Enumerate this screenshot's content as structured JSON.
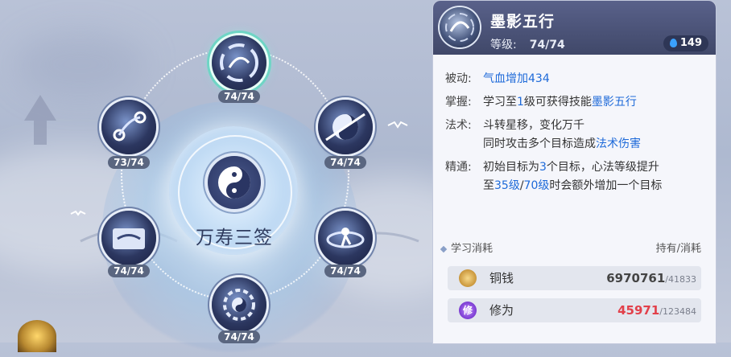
{
  "skill_tree": {
    "center_title": "万寿三签",
    "nodes": [
      {
        "id": "top",
        "label": "74/74",
        "active": true
      },
      {
        "id": "upper-left",
        "label": "73/74",
        "active": false
      },
      {
        "id": "upper-right",
        "label": "74/74",
        "active": false
      },
      {
        "id": "lower-left",
        "label": "74/74",
        "active": false
      },
      {
        "id": "lower-right",
        "label": "74/74",
        "active": false
      },
      {
        "id": "bottom",
        "label": "74/74",
        "active": false
      }
    ]
  },
  "detail": {
    "title": "墨影五行",
    "level_label": "等级:",
    "level_value": "74/74",
    "currency_badge": "149",
    "rows": [
      {
        "key": "被动:",
        "text_prefix": "",
        "highlight": "气血增加434",
        "text_suffix": ""
      },
      {
        "key": "掌握:",
        "text_prefix": "学习至",
        "highlight": "1",
        "text_suffix": "级可获得技能",
        "highlight2": "墨影五行"
      },
      {
        "key": "法术:",
        "line1": "斗转星移，变化万千",
        "line2_prefix": "同时攻击多个目标造成",
        "line2_highlight": "法术伤害"
      },
      {
        "key": "精通:",
        "line1_prefix": "初始目标为",
        "line1_highlight": "3",
        "line1_suffix": "个目标，心法等级提升",
        "line2_prefix": "至",
        "line2_highlight": "35级",
        "line2_mid": "/",
        "line2_highlight2": "70级",
        "line2_suffix": "时会额外增加一个目标"
      }
    ],
    "cost_section": {
      "label": "学习消耗",
      "right_label": "持有/消耗",
      "items": [
        {
          "name": "铜钱",
          "held": "6970761",
          "cost": "/41833",
          "held_color": "#444444"
        },
        {
          "name": "修为",
          "held": "45971",
          "cost": "/123484",
          "held_color": "#e2404a",
          "icon_char": "修"
        }
      ]
    }
  }
}
